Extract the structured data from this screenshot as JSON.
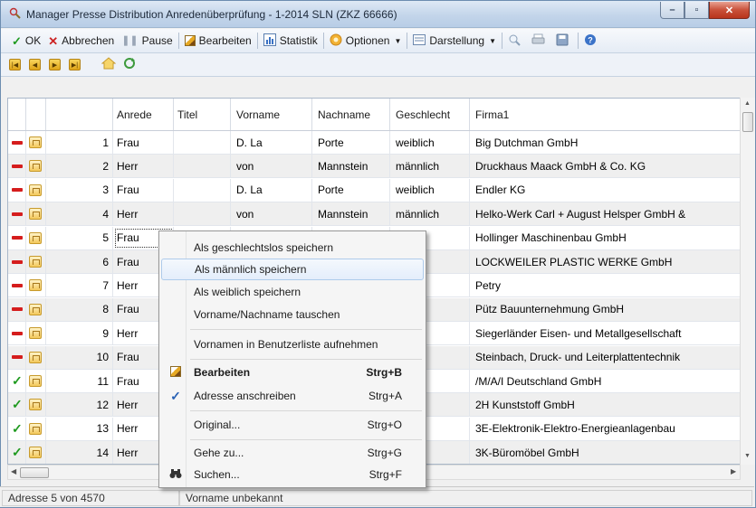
{
  "window": {
    "title": "Manager Presse Distribution Anredenüberprüfung - 1-2014 SLN  (ZKZ 66666)",
    "controls": [
      "–",
      "▫",
      "✕"
    ]
  },
  "toolbar": {
    "ok": "OK",
    "cancel": "Abbrechen",
    "pause": "Pause",
    "edit": "Bearbeiten",
    "stats": "Statistik",
    "options": "Optionen",
    "display": "Darstellung"
  },
  "grid": {
    "columns": [
      "Anrede",
      "Titel",
      "Vorname",
      "Nachname",
      "Geschlecht",
      "Firma1"
    ],
    "rows": [
      {
        "status": "dash",
        "num": "1",
        "anrede": "Frau",
        "titel": "",
        "vorname": "D. La",
        "nachname": "Porte",
        "geschlecht": "weiblich",
        "firma": "Big Dutchman GmbH"
      },
      {
        "status": "dash",
        "num": "2",
        "anrede": "Herr",
        "titel": "",
        "vorname": "von",
        "nachname": "Mannstein",
        "geschlecht": "männlich",
        "firma": "Druckhaus Maack GmbH & Co. KG"
      },
      {
        "status": "dash",
        "num": "3",
        "anrede": "Frau",
        "titel": "",
        "vorname": "D. La",
        "nachname": "Porte",
        "geschlecht": "weiblich",
        "firma": "Endler KG"
      },
      {
        "status": "dash",
        "num": "4",
        "anrede": "Herr",
        "titel": "",
        "vorname": "von",
        "nachname": "Mannstein",
        "geschlecht": "männlich",
        "firma": "Helko-Werk Carl + August Helsper GmbH &"
      },
      {
        "status": "dash",
        "num": "5",
        "anrede": "Frau",
        "titel": "",
        "vorname": "",
        "nachname": "",
        "geschlecht": "",
        "firma": "Hollinger Maschinenbau GmbH"
      },
      {
        "status": "dash",
        "num": "6",
        "anrede": "Frau",
        "titel": "",
        "vorname": "",
        "nachname": "",
        "geschlecht": "h",
        "firma": "LOCKWEILER PLASTIC WERKE GmbH"
      },
      {
        "status": "dash",
        "num": "7",
        "anrede": "Herr",
        "titel": "",
        "vorname": "",
        "nachname": "",
        "geschlecht": "h",
        "firma": "Petry"
      },
      {
        "status": "dash",
        "num": "8",
        "anrede": "Frau",
        "titel": "",
        "vorname": "",
        "nachname": "",
        "geschlecht": "",
        "firma": "Pütz Bauunternehmung GmbH"
      },
      {
        "status": "dash",
        "num": "9",
        "anrede": "Herr",
        "titel": "",
        "vorname": "",
        "nachname": "",
        "geschlecht": "h",
        "firma": "Siegerländer Eisen- und Metallgesellschaft"
      },
      {
        "status": "dash",
        "num": "10",
        "anrede": "Frau",
        "titel": "",
        "vorname": "",
        "nachname": "",
        "geschlecht": "",
        "firma": "Steinbach, Druck- und Leiterplattentechnik"
      },
      {
        "status": "check",
        "num": "11",
        "anrede": "Frau",
        "titel": "",
        "vorname": "",
        "nachname": "",
        "geschlecht": "",
        "firma": "/M/A/I Deutschland GmbH"
      },
      {
        "status": "check",
        "num": "12",
        "anrede": "Herr",
        "titel": "",
        "vorname": "",
        "nachname": "",
        "geschlecht": "h",
        "firma": "2H Kunststoff GmbH"
      },
      {
        "status": "check",
        "num": "13",
        "anrede": "Herr",
        "titel": "",
        "vorname": "",
        "nachname": "",
        "geschlecht": "h",
        "firma": "3E-Elektronik-Elektro-Energieanlagenbau"
      },
      {
        "status": "check",
        "num": "14",
        "anrede": "Herr",
        "titel": "",
        "vorname": "",
        "nachname": "",
        "geschlecht": "h",
        "firma": "3K-Büromöbel GmbH"
      }
    ]
  },
  "context_menu": {
    "items": [
      {
        "label": "Als geschlechtslos speichern",
        "shortcut": ""
      },
      {
        "label": "Als männlich speichern",
        "shortcut": ""
      },
      {
        "label": "Als weiblich speichern",
        "shortcut": ""
      },
      {
        "label": "Vorname/Nachname tauschen",
        "shortcut": ""
      },
      {
        "label": "Vornamen in Benutzerliste aufnehmen",
        "shortcut": ""
      },
      {
        "label": "Bearbeiten",
        "shortcut": "Strg+B"
      },
      {
        "label": "Adresse anschreiben",
        "shortcut": "Strg+A"
      },
      {
        "label": "Original...",
        "shortcut": "Strg+O"
      },
      {
        "label": "Gehe zu...",
        "shortcut": "Strg+G"
      },
      {
        "label": "Suchen...",
        "shortcut": "Strg+F"
      }
    ]
  },
  "status": {
    "position": "Adresse 5 von 4570",
    "message": "Vorname unbekannt"
  },
  "colors": {
    "status_red": "#d51d1d",
    "status_green": "#1f9a1f",
    "highlight": "#aecbeb"
  }
}
